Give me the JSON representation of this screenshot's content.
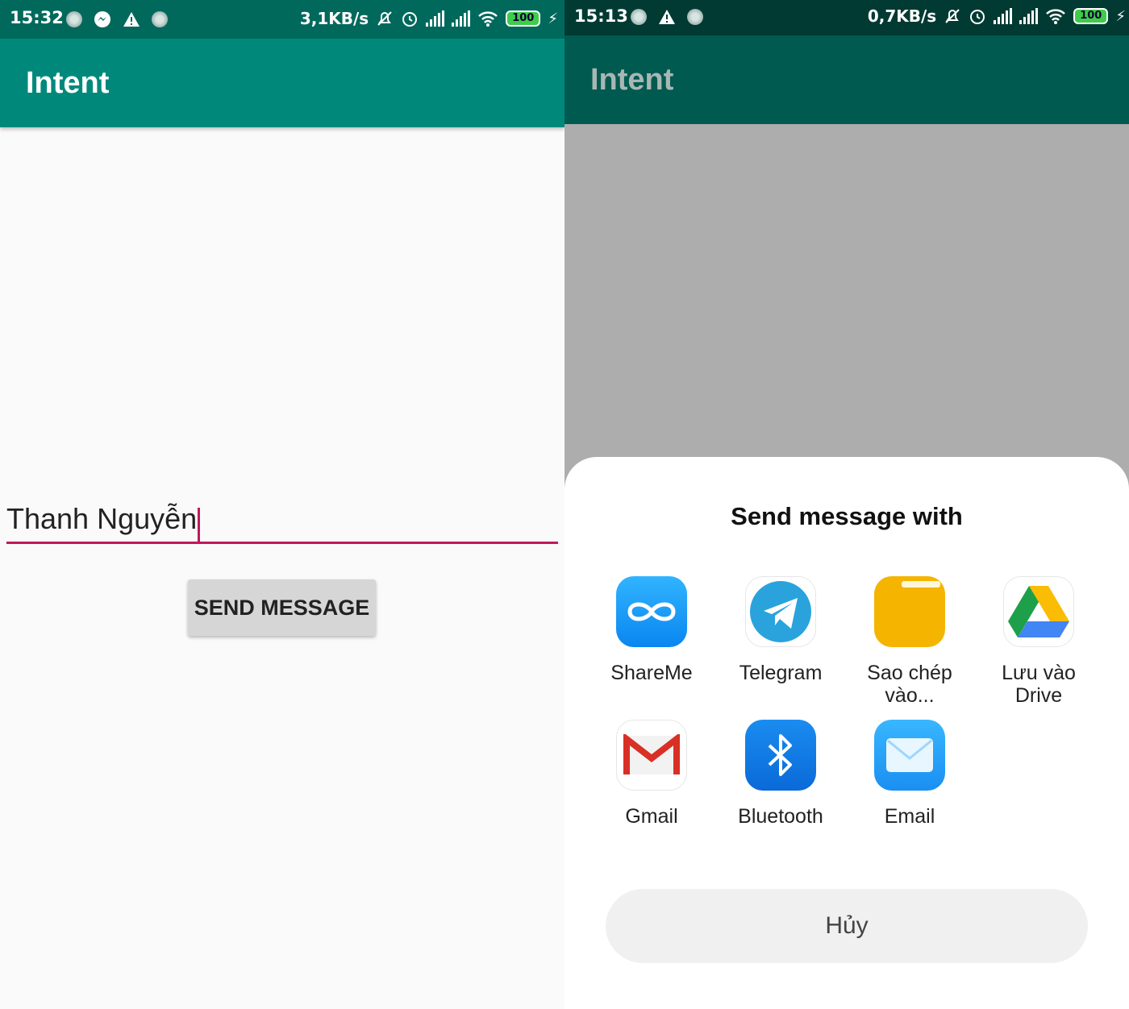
{
  "left_screen": {
    "status_bar": {
      "time": "15:32",
      "speed": "3,1KB/s",
      "battery": "100"
    },
    "app_title": "Intent",
    "message_input": {
      "value": "Thanh Nguyễn"
    },
    "send_button_label": "SEND MESSAGE"
  },
  "right_screen": {
    "status_bar": {
      "time": "15:13",
      "speed": "0,7KB/s",
      "battery": "100"
    },
    "app_title": "Intent",
    "share_sheet": {
      "title": "Send message with",
      "apps": [
        {
          "label": "ShareMe",
          "icon": "shareme-icon"
        },
        {
          "label": "Telegram",
          "icon": "telegram-icon"
        },
        {
          "label": "Sao chép vào...",
          "icon": "folder-icon"
        },
        {
          "label": "Lưu vào Drive",
          "icon": "drive-icon"
        },
        {
          "label": "Gmail",
          "icon": "gmail-icon"
        },
        {
          "label": "Bluetooth",
          "icon": "bluetooth-icon"
        },
        {
          "label": "Email",
          "icon": "email-icon"
        }
      ],
      "cancel_label": "Hủy"
    }
  },
  "colors": {
    "primary": "#00897b",
    "primary_dark": "#00695c",
    "accent": "#c2185b"
  }
}
